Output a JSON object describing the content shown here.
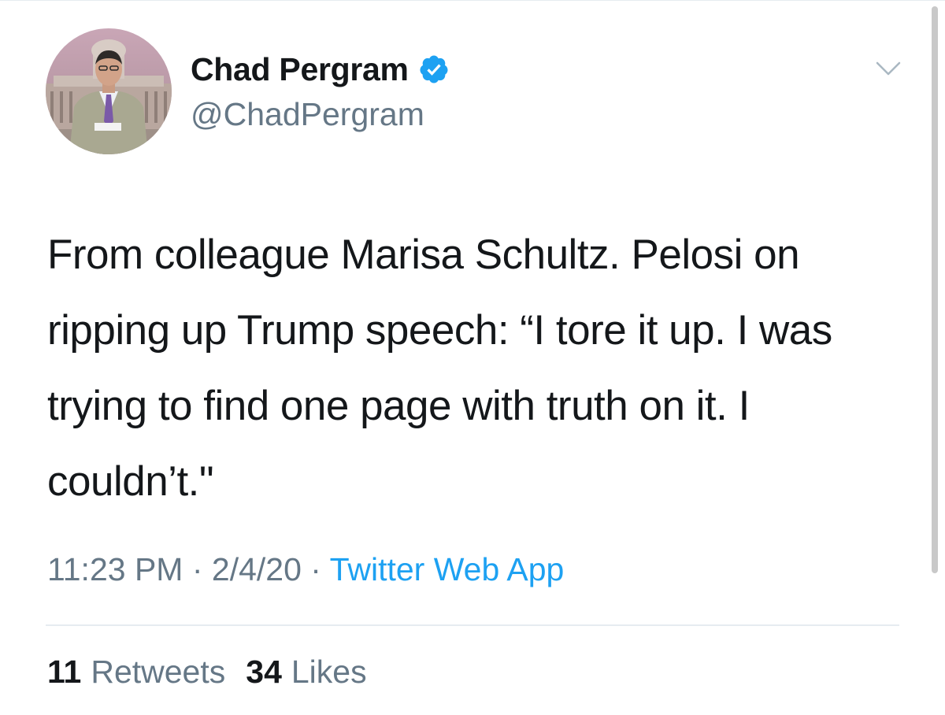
{
  "tweet": {
    "author": {
      "display_name": "Chad Pergram",
      "handle": "@ChadPergram",
      "avatar_icon": "profile-photo",
      "verified_icon": "verified-badge-icon"
    },
    "menu_icon": "chevron-down-icon",
    "text": "From colleague Marisa Schultz. Pelosi on ripping up Trump speech: “I tore it up. I was trying to find one page with truth on it. I couldn’t.\"",
    "time": "11:23 PM",
    "separator": " · ",
    "date": "2/4/20",
    "source": "Twitter Web App",
    "retweets": {
      "count": "11",
      "label": "Retweets"
    },
    "likes": {
      "count": "34",
      "label": "Likes"
    }
  },
  "colors": {
    "text": "#14171a",
    "secondary": "#657786",
    "accent": "#1da1f2",
    "divider": "#e6ecf0"
  }
}
